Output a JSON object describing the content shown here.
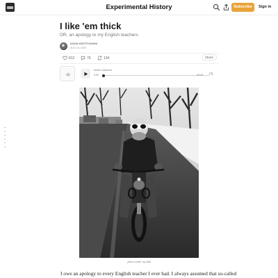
{
  "header": {
    "site_title": "Experimental History",
    "subscribe_label": "Subscribe",
    "signin_label": "Sign in",
    "accent_color": "#e8a33a"
  },
  "post": {
    "title": "I like 'em thick",
    "subtitle": "OR, an apology to my English teachers",
    "author": "ADAM MASTROIANNI",
    "date": "AUG 18, 2026"
  },
  "actions": {
    "likes": "812",
    "comments": "76",
    "restacks": "134",
    "share_label": "Share"
  },
  "audio": {
    "label": "Article voiceover",
    "time_elapsed": "0:00",
    "time_remaining": "-22:42",
    "progress": 0
  },
  "photo": {
    "caption": "photo credit: my dad"
  },
  "body": {
    "first_line": "I owe an apology to every English teacher I ever had. I always assumed that so-called"
  },
  "icons": {
    "logo": "site-logo",
    "search": "search-icon",
    "share": "share-icon",
    "like": "heart-icon",
    "comment": "comment-icon",
    "restack": "restack-icon",
    "play": "play-icon",
    "speed": "playback-speed-icon"
  }
}
